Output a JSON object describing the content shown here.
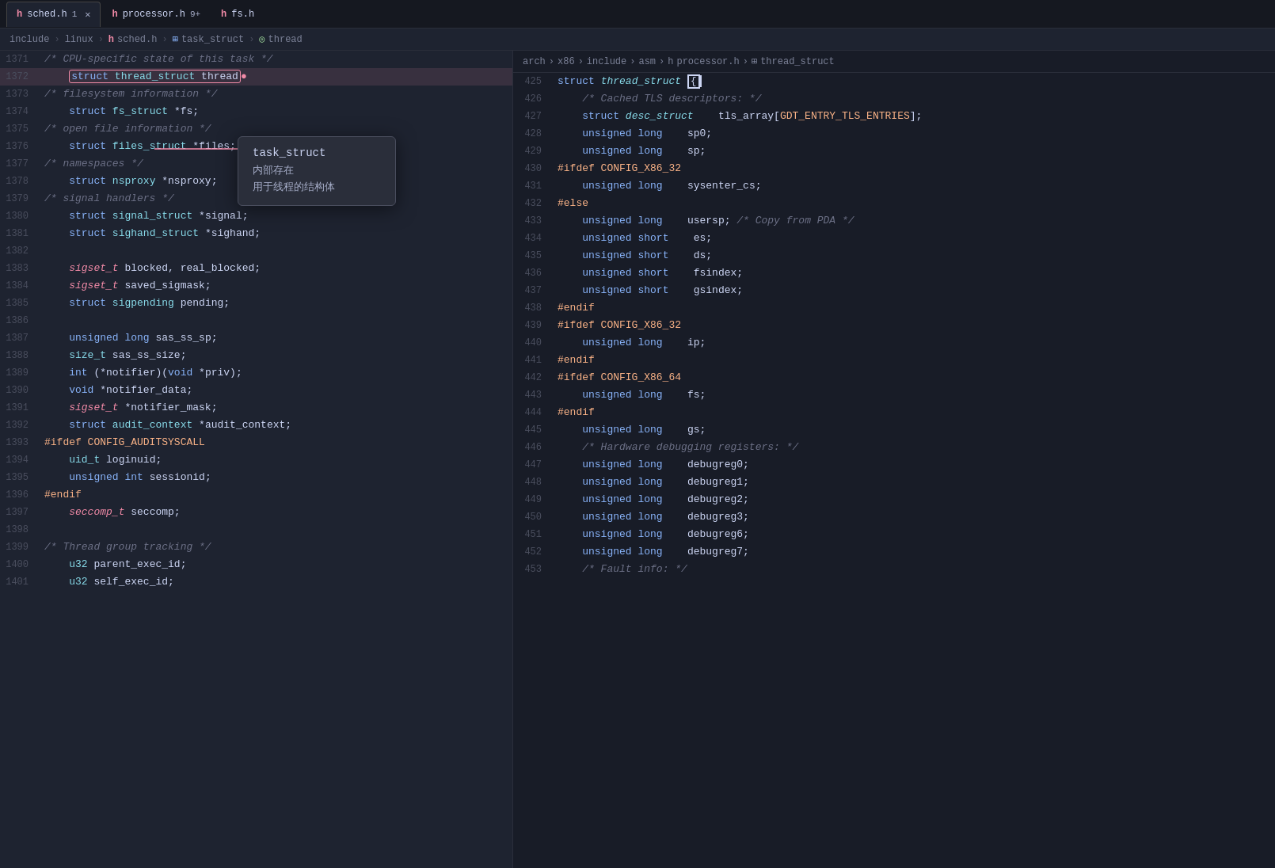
{
  "tabs": [
    {
      "id": "sched",
      "lang": "h",
      "name": "sched.h",
      "badge": "1",
      "active": true,
      "closable": true
    },
    {
      "id": "processor",
      "lang": "h",
      "name": "processor.h",
      "badge": "9+",
      "active": false,
      "closable": false
    },
    {
      "id": "fs",
      "lang": "h",
      "name": "fs.h",
      "badge": "",
      "active": false,
      "closable": false
    }
  ],
  "left_breadcrumb": {
    "parts": [
      "include",
      ">",
      "linux",
      ">",
      "h",
      "sched.h",
      ">",
      "struct_icon",
      "task_struct",
      ">",
      "thread_icon",
      "thread"
    ]
  },
  "right_breadcrumb": {
    "parts": [
      "arch",
      ">",
      "x86",
      ">",
      "include",
      ">",
      "asm",
      ">",
      "h",
      "processor.h",
      ">",
      "struct_icon",
      "thread_struct"
    ]
  },
  "tooltip": {
    "title": "task_struct",
    "lines": [
      "内部存在",
      "用于线程的结构体"
    ]
  },
  "left_lines": [
    {
      "num": "1371",
      "content": "/* CPU-specific state of this task */",
      "type": "comment"
    },
    {
      "num": "1372",
      "content": "    struct thread_struct thread",
      "type": "highlighted"
    },
    {
      "num": "1373",
      "content": "/* filesystem information */",
      "type": "comment_indent"
    },
    {
      "num": "1374",
      "content": "    struct fs_struct *fs;",
      "type": "code"
    },
    {
      "num": "1375",
      "content": "/* open file information */",
      "type": "comment_indent"
    },
    {
      "num": "1376",
      "content": "    struct files_struct *files;",
      "type": "code"
    },
    {
      "num": "1377",
      "content": "/* namespaces */",
      "type": "comment_indent"
    },
    {
      "num": "1378",
      "content": "    struct nsproxy *nsproxy;",
      "type": "code"
    },
    {
      "num": "1379",
      "content": "/* signal handlers */",
      "type": "comment_indent"
    },
    {
      "num": "1380",
      "content": "    struct signal_struct *signal;",
      "type": "code"
    },
    {
      "num": "1381",
      "content": "    struct sighand_struct *sighand;",
      "type": "code"
    },
    {
      "num": "1382",
      "content": "",
      "type": "empty"
    },
    {
      "num": "1383",
      "content": "    sigset_t blocked, real_blocked;",
      "type": "code_sig"
    },
    {
      "num": "1384",
      "content": "    sigset_t saved_sigmask;",
      "type": "code_sig"
    },
    {
      "num": "1385",
      "content": "    struct sigpending pending;",
      "type": "code"
    },
    {
      "num": "1386",
      "content": "",
      "type": "empty"
    },
    {
      "num": "1387",
      "content": "    unsigned long sas_ss_sp;",
      "type": "code_ul"
    },
    {
      "num": "1388",
      "content": "    size_t sas_ss_size;",
      "type": "code_size"
    },
    {
      "num": "1389",
      "content": "    int (*notifier)(void *priv);",
      "type": "code_int"
    },
    {
      "num": "1390",
      "content": "    void *notifier_data;",
      "type": "code_void"
    },
    {
      "num": "1391",
      "content": "    sigset_t *notifier_mask;",
      "type": "code_sig2"
    },
    {
      "num": "1392",
      "content": "    struct audit_context *audit_context;",
      "type": "code"
    },
    {
      "num": "1393",
      "content": "#ifdef CONFIG_AUDITSYSCALL",
      "type": "macro"
    },
    {
      "num": "1394",
      "content": "    uid_t loginuid;",
      "type": "code_uid"
    },
    {
      "num": "1395",
      "content": "    unsigned int sessionid;",
      "type": "code_uint"
    },
    {
      "num": "1396",
      "content": "#endif",
      "type": "macro"
    },
    {
      "num": "1397",
      "content": "    seccomp_t seccomp;",
      "type": "code_seccomp"
    },
    {
      "num": "1398",
      "content": "",
      "type": "empty"
    },
    {
      "num": "1399",
      "content": "/* Thread group tracking */",
      "type": "comment_indent"
    },
    {
      "num": "1400",
      "content": "    u32 parent_exec_id;",
      "type": "code_u32"
    },
    {
      "num": "1401",
      "content": "    u32 self_exec_id;",
      "type": "code_u32"
    }
  ],
  "right_lines": [
    {
      "num": "425",
      "content": "struct thread_struct {",
      "type": "struct_open"
    },
    {
      "num": "426",
      "content": "    /* Cached TLS descriptors: */",
      "type": "comment_indent"
    },
    {
      "num": "427",
      "content": "    struct desc_struct    tls_array[GDT_ENTRY_TLS_ENTRIES];",
      "type": "code_desc"
    },
    {
      "num": "428",
      "content": "    unsigned long    sp0;",
      "type": "code_ul"
    },
    {
      "num": "429",
      "content": "    unsigned long    sp;",
      "type": "code_ul"
    },
    {
      "num": "430",
      "content": "#ifdef CONFIG_X86_32",
      "type": "macro"
    },
    {
      "num": "431",
      "content": "    unsigned long    sysenter_cs;",
      "type": "code_ul"
    },
    {
      "num": "432",
      "content": "#else",
      "type": "macro"
    },
    {
      "num": "433",
      "content": "    unsigned long    usersp; /* Copy from PDA */",
      "type": "code_ul_comment"
    },
    {
      "num": "434",
      "content": "    unsigned short    es;",
      "type": "code_us"
    },
    {
      "num": "435",
      "content": "    unsigned short    ds;",
      "type": "code_us"
    },
    {
      "num": "436",
      "content": "    unsigned short    fsindex;",
      "type": "code_us"
    },
    {
      "num": "437",
      "content": "    unsigned short    gsindex;",
      "type": "code_us"
    },
    {
      "num": "438",
      "content": "#endif",
      "type": "macro"
    },
    {
      "num": "439",
      "content": "#ifdef CONFIG_X86_32",
      "type": "macro"
    },
    {
      "num": "440",
      "content": "    unsigned long    ip;",
      "type": "code_ul"
    },
    {
      "num": "441",
      "content": "#endif",
      "type": "macro"
    },
    {
      "num": "442",
      "content": "#ifdef CONFIG_X86_64",
      "type": "macro"
    },
    {
      "num": "443",
      "content": "    unsigned long    fs;",
      "type": "code_ul"
    },
    {
      "num": "444",
      "content": "#endif",
      "type": "macro"
    },
    {
      "num": "445",
      "content": "    unsigned long    gs;",
      "type": "code_ul"
    },
    {
      "num": "446",
      "content": "    /* Hardware debugging registers: */",
      "type": "comment_indent"
    },
    {
      "num": "447",
      "content": "    unsigned long    debugreg0;",
      "type": "code_ul"
    },
    {
      "num": "448",
      "content": "    unsigned long    debugreg1;",
      "type": "code_ul"
    },
    {
      "num": "449",
      "content": "    unsigned long    debugreg2;",
      "type": "code_ul"
    },
    {
      "num": "450",
      "content": "    unsigned long    debugreg3;",
      "type": "code_ul"
    },
    {
      "num": "451",
      "content": "    unsigned long    debugreg6;",
      "type": "code_ul"
    },
    {
      "num": "452",
      "content": "    unsigned long    debugreg7;",
      "type": "code_ul"
    },
    {
      "num": "453",
      "content": "    /* Fault info: */",
      "type": "comment_indent"
    }
  ],
  "colors": {
    "bg_left": "#1e2330",
    "bg_right": "#181c27",
    "tab_bar": "#151820",
    "accent": "#f38ba8",
    "keyword": "#89b4fa",
    "type_color": "#89dceb",
    "macro_color": "#fab387",
    "comment_color": "#6c7086",
    "pink": "#f38ba8",
    "green": "#a6e3a1"
  }
}
